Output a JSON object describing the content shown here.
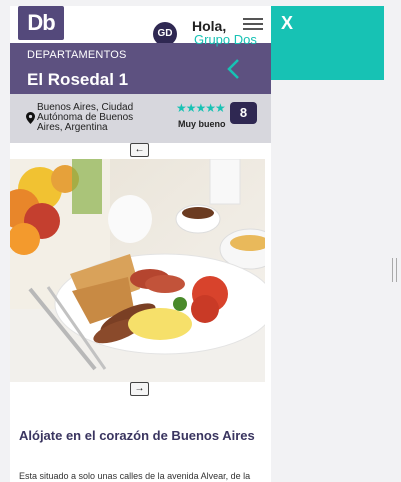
{
  "header": {
    "logo_text": "Db",
    "avatar_initials": "GD",
    "greeting": "Hola,",
    "username": "Grupo Dos"
  },
  "side_panel": {
    "close_label": "X",
    "color": "#17c2b4"
  },
  "property": {
    "category": "DEPARTAMENTOS",
    "title": "El Rosedal 1",
    "address_line1": "Buenos Aires, Ciudad",
    "address_line2": "Autónoma de Buenos",
    "address_line3": "Aires, Argentina",
    "stars": "★★★★★",
    "rating_label": "Muy bueno",
    "score": "8"
  },
  "gallery": {
    "prev_label": "←",
    "next_label": "→"
  },
  "content": {
    "heading": "Alójate en el corazón de Buenos Aires",
    "paragraph": "Esta situado a solo unas calles de la avenida Alvear, de la"
  },
  "colors": {
    "brand": "#54497b",
    "header_band": "#5d5180",
    "info_band": "#d7d7dd",
    "score_badge": "#2f2852"
  }
}
